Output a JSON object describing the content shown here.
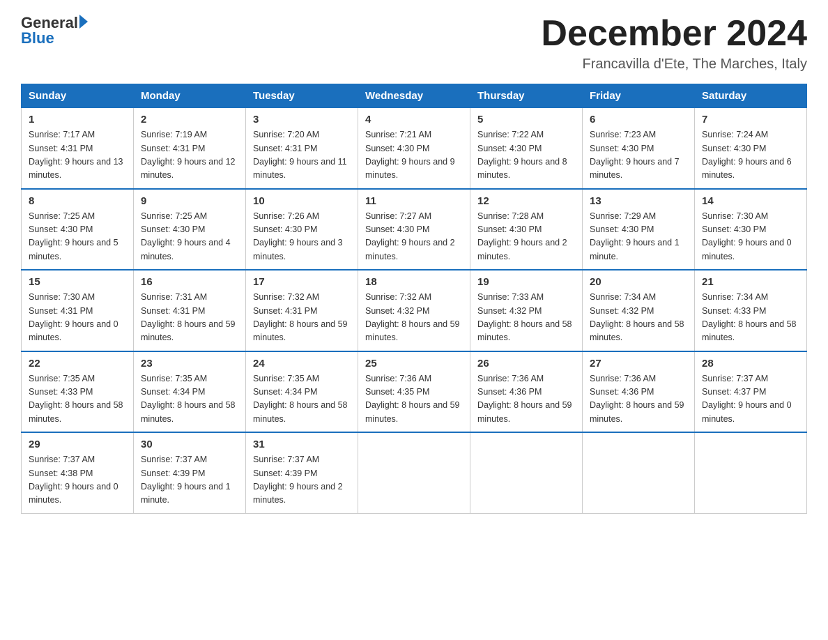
{
  "header": {
    "logo_general": "General",
    "logo_blue": "Blue",
    "month_title": "December 2024",
    "location": "Francavilla d'Ete, The Marches, Italy"
  },
  "days_of_week": [
    "Sunday",
    "Monday",
    "Tuesday",
    "Wednesday",
    "Thursday",
    "Friday",
    "Saturday"
  ],
  "weeks": [
    [
      {
        "day": "1",
        "sunrise": "7:17 AM",
        "sunset": "4:31 PM",
        "daylight": "9 hours and 13 minutes."
      },
      {
        "day": "2",
        "sunrise": "7:19 AM",
        "sunset": "4:31 PM",
        "daylight": "9 hours and 12 minutes."
      },
      {
        "day": "3",
        "sunrise": "7:20 AM",
        "sunset": "4:31 PM",
        "daylight": "9 hours and 11 minutes."
      },
      {
        "day": "4",
        "sunrise": "7:21 AM",
        "sunset": "4:30 PM",
        "daylight": "9 hours and 9 minutes."
      },
      {
        "day": "5",
        "sunrise": "7:22 AM",
        "sunset": "4:30 PM",
        "daylight": "9 hours and 8 minutes."
      },
      {
        "day": "6",
        "sunrise": "7:23 AM",
        "sunset": "4:30 PM",
        "daylight": "9 hours and 7 minutes."
      },
      {
        "day": "7",
        "sunrise": "7:24 AM",
        "sunset": "4:30 PM",
        "daylight": "9 hours and 6 minutes."
      }
    ],
    [
      {
        "day": "8",
        "sunrise": "7:25 AM",
        "sunset": "4:30 PM",
        "daylight": "9 hours and 5 minutes."
      },
      {
        "day": "9",
        "sunrise": "7:25 AM",
        "sunset": "4:30 PM",
        "daylight": "9 hours and 4 minutes."
      },
      {
        "day": "10",
        "sunrise": "7:26 AM",
        "sunset": "4:30 PM",
        "daylight": "9 hours and 3 minutes."
      },
      {
        "day": "11",
        "sunrise": "7:27 AM",
        "sunset": "4:30 PM",
        "daylight": "9 hours and 2 minutes."
      },
      {
        "day": "12",
        "sunrise": "7:28 AM",
        "sunset": "4:30 PM",
        "daylight": "9 hours and 2 minutes."
      },
      {
        "day": "13",
        "sunrise": "7:29 AM",
        "sunset": "4:30 PM",
        "daylight": "9 hours and 1 minute."
      },
      {
        "day": "14",
        "sunrise": "7:30 AM",
        "sunset": "4:30 PM",
        "daylight": "9 hours and 0 minutes."
      }
    ],
    [
      {
        "day": "15",
        "sunrise": "7:30 AM",
        "sunset": "4:31 PM",
        "daylight": "9 hours and 0 minutes."
      },
      {
        "day": "16",
        "sunrise": "7:31 AM",
        "sunset": "4:31 PM",
        "daylight": "8 hours and 59 minutes."
      },
      {
        "day": "17",
        "sunrise": "7:32 AM",
        "sunset": "4:31 PM",
        "daylight": "8 hours and 59 minutes."
      },
      {
        "day": "18",
        "sunrise": "7:32 AM",
        "sunset": "4:32 PM",
        "daylight": "8 hours and 59 minutes."
      },
      {
        "day": "19",
        "sunrise": "7:33 AM",
        "sunset": "4:32 PM",
        "daylight": "8 hours and 58 minutes."
      },
      {
        "day": "20",
        "sunrise": "7:34 AM",
        "sunset": "4:32 PM",
        "daylight": "8 hours and 58 minutes."
      },
      {
        "day": "21",
        "sunrise": "7:34 AM",
        "sunset": "4:33 PM",
        "daylight": "8 hours and 58 minutes."
      }
    ],
    [
      {
        "day": "22",
        "sunrise": "7:35 AM",
        "sunset": "4:33 PM",
        "daylight": "8 hours and 58 minutes."
      },
      {
        "day": "23",
        "sunrise": "7:35 AM",
        "sunset": "4:34 PM",
        "daylight": "8 hours and 58 minutes."
      },
      {
        "day": "24",
        "sunrise": "7:35 AM",
        "sunset": "4:34 PM",
        "daylight": "8 hours and 58 minutes."
      },
      {
        "day": "25",
        "sunrise": "7:36 AM",
        "sunset": "4:35 PM",
        "daylight": "8 hours and 59 minutes."
      },
      {
        "day": "26",
        "sunrise": "7:36 AM",
        "sunset": "4:36 PM",
        "daylight": "8 hours and 59 minutes."
      },
      {
        "day": "27",
        "sunrise": "7:36 AM",
        "sunset": "4:36 PM",
        "daylight": "8 hours and 59 minutes."
      },
      {
        "day": "28",
        "sunrise": "7:37 AM",
        "sunset": "4:37 PM",
        "daylight": "9 hours and 0 minutes."
      }
    ],
    [
      {
        "day": "29",
        "sunrise": "7:37 AM",
        "sunset": "4:38 PM",
        "daylight": "9 hours and 0 minutes."
      },
      {
        "day": "30",
        "sunrise": "7:37 AM",
        "sunset": "4:39 PM",
        "daylight": "9 hours and 1 minute."
      },
      {
        "day": "31",
        "sunrise": "7:37 AM",
        "sunset": "4:39 PM",
        "daylight": "9 hours and 2 minutes."
      },
      null,
      null,
      null,
      null
    ]
  ]
}
